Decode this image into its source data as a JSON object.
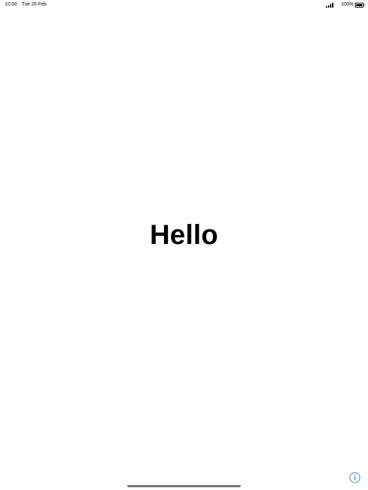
{
  "status_bar": {
    "time": "10:00",
    "date": "Tue 26 Feb",
    "signal_icon": "cellular-signal-icon",
    "battery_percent_label": "100%",
    "battery_level": 1.0,
    "battery_icon": "battery-icon"
  },
  "main": {
    "greeting": "Hello"
  },
  "info_button": {
    "icon": "info-icon",
    "color": "#3b8fd9"
  },
  "home_indicator": {
    "color": "#6f6f6f"
  }
}
